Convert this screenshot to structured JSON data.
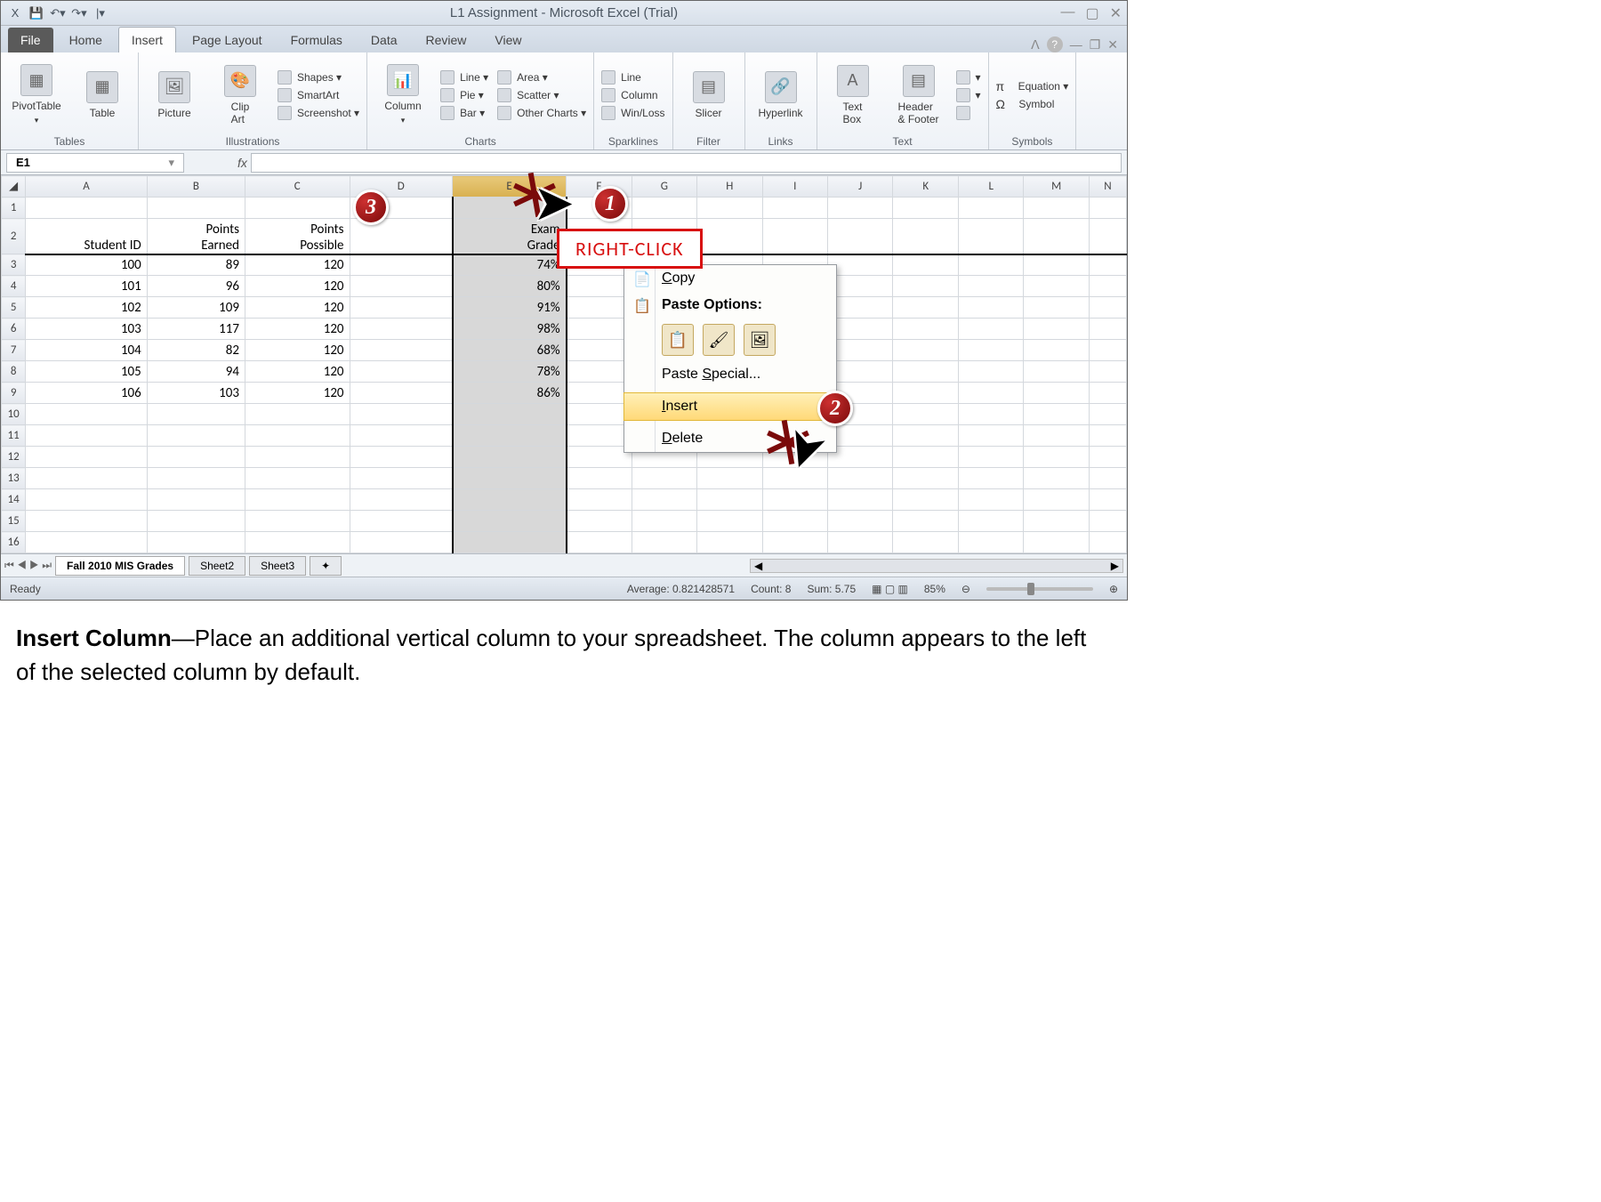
{
  "title": "L1 Assignment - Microsoft Excel (Trial)",
  "tabs": {
    "file": "File",
    "home": "Home",
    "insert": "Insert",
    "pageLayout": "Page Layout",
    "formulas": "Formulas",
    "data": "Data",
    "review": "Review",
    "view": "View"
  },
  "ribbon": {
    "tables": {
      "pivot": "PivotTable",
      "table": "Table",
      "label": "Tables"
    },
    "illustrations": {
      "picture": "Picture",
      "clipart": "Clip\nArt",
      "shapes": "Shapes ▾",
      "smartart": "SmartArt",
      "screenshot": "Screenshot ▾",
      "label": "Illustrations"
    },
    "charts": {
      "column": "Column",
      "line": "Line ▾",
      "pie": "Pie ▾",
      "bar": "Bar ▾",
      "area": "Area ▾",
      "scatter": "Scatter ▾",
      "other": "Other Charts ▾",
      "label": "Charts"
    },
    "sparklines": {
      "line": "Line",
      "column": "Column",
      "winloss": "Win/Loss",
      "label": "Sparklines"
    },
    "filter": {
      "slicer": "Slicer",
      "label": "Filter"
    },
    "links": {
      "hyperlink": "Hyperlink",
      "label": "Links"
    },
    "text": {
      "textbox": "Text\nBox",
      "header": "Header\n& Footer",
      "label": "Text"
    },
    "symbols": {
      "equation": "Equation ▾",
      "symbol": "Symbol",
      "label": "Symbols"
    }
  },
  "nameBox": "E1",
  "fx": "fx",
  "columns": [
    "A",
    "B",
    "C",
    "D",
    "E",
    "F",
    "G",
    "H",
    "I",
    "J",
    "K",
    "L",
    "M",
    "N"
  ],
  "headers": {
    "a2": "Student ID",
    "b1": "Points",
    "b2": "Earned",
    "c1": "Points",
    "c2": "Possible",
    "e1": "Exam",
    "e2": "Grade"
  },
  "rows": [
    {
      "r": "3",
      "a": "100",
      "b": "89",
      "c": "120",
      "e": "74%"
    },
    {
      "r": "4",
      "a": "101",
      "b": "96",
      "c": "120",
      "e": "80%"
    },
    {
      "r": "5",
      "a": "102",
      "b": "109",
      "c": "120",
      "e": "91%"
    },
    {
      "r": "6",
      "a": "103",
      "b": "117",
      "c": "120",
      "e": "98%"
    },
    {
      "r": "7",
      "a": "104",
      "b": "82",
      "c": "120",
      "e": "68%"
    },
    {
      "r": "8",
      "a": "105",
      "b": "94",
      "c": "120",
      "e": "78%"
    },
    {
      "r": "9",
      "a": "106",
      "b": "103",
      "c": "120",
      "e": "86%"
    }
  ],
  "emptyRows": [
    "10",
    "11",
    "12",
    "13",
    "14",
    "15",
    "16"
  ],
  "context": {
    "copy": "Copy",
    "pasteOptions": "Paste Options:",
    "pasteSpecial": "Paste Special...",
    "insert": "Insert",
    "delete": "Delete"
  },
  "rcLabel": "RIGHT-CLICK",
  "sheetTabs": {
    "s1": "Fall 2010 MIS Grades",
    "s2": "Sheet2",
    "s3": "Sheet3"
  },
  "status": {
    "ready": "Ready",
    "avg": "Average: 0.821428571",
    "count": "Count: 8",
    "sum": "Sum: 5.75",
    "zoom": "85%"
  },
  "badges": {
    "b1": "1",
    "b2": "2",
    "b3": "3"
  },
  "caption": {
    "bold": "Insert Column",
    "rest": "—Place an additional vertical column to your spreadsheet.  The column appears to the left of the selected column by default."
  }
}
